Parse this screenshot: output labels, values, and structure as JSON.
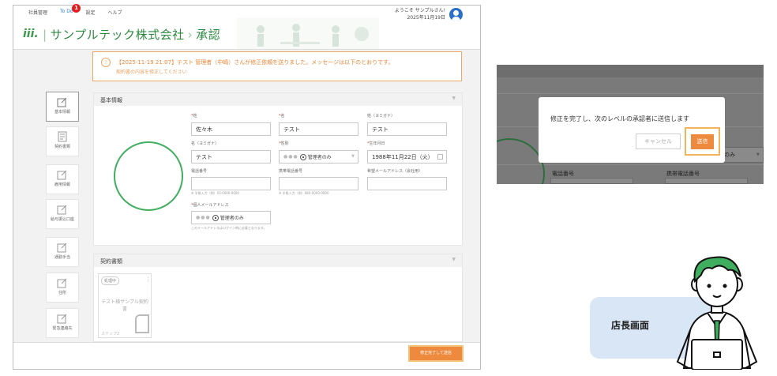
{
  "nav": {
    "items": [
      "社員管理",
      "To Do",
      "設定",
      "ヘルプ"
    ],
    "todo_badge": "1"
  },
  "user": {
    "welcome": "ようこそ サンプルさん!",
    "date": "2025年11月19日"
  },
  "brand": {
    "logo": "iii.",
    "company": "サンプルテック株式会社",
    "separator": "›",
    "page": "承認"
  },
  "alert": {
    "icon": "!",
    "message": "【2025-11-19 21:07】テスト 管理者（中嶋）さんが修正依頼を送りました。メッセージは以下のとおりです。",
    "sub": "契約書の内容を修正してください"
  },
  "sidenav": [
    {
      "label": "基本情報",
      "active": true
    },
    {
      "label": "契約書類",
      "active": false
    },
    {
      "label": "雇用情報",
      "active": false
    },
    {
      "label": "給与振込口座",
      "active": false
    },
    {
      "label": "通勤手当",
      "active": false
    },
    {
      "label": "住所",
      "active": false
    },
    {
      "label": "緊急連絡先",
      "active": false
    }
  ],
  "basic_info": {
    "title": "基本情報",
    "last_name": {
      "label": "姓",
      "required": true,
      "value": "佐々木"
    },
    "first_name": {
      "label": "名",
      "required": true,
      "value": "テスト"
    },
    "last_kana": {
      "label": "姓（ヨミガナ）",
      "required": false,
      "value": "テスト"
    },
    "first_kana": {
      "label": "名（ヨミガナ）",
      "required": false,
      "value": "テスト"
    },
    "gender": {
      "label": "性別",
      "required": true,
      "dots": "●●●",
      "value": "管理者のみ"
    },
    "birthday": {
      "label": "生年月日",
      "required": true,
      "value": "1988年11月22日（火）"
    },
    "phone": {
      "label": "電話番号",
      "value": "",
      "hint": "※ 半角入力（例）03-0000-0000"
    },
    "mobile": {
      "label": "携帯電話番号",
      "value": "",
      "hint": "※ 半角入力（例）080-0000-0000"
    },
    "work_email": {
      "label": "希望メールアドレス（会社用）",
      "value": ""
    },
    "personal_email": {
      "label": "個人メールアドレス",
      "required": true,
      "dots": "●●●",
      "value": "管理者のみ",
      "hint": "このメールアドレスはログイン時に必要となります。"
    }
  },
  "contracts": {
    "title": "契約書類",
    "card": {
      "tag": "処理中",
      "menu": "⋮",
      "title": "テスト様サンプル契約書",
      "step": "ステップ2"
    }
  },
  "footer": {
    "complete_button": "修正完了して送信"
  },
  "modal_shot": {
    "message": "修正を完了し、次のレベルの承認者に送信します",
    "cancel": "キャンセル",
    "send": "送信",
    "bg_phone": "電話番号",
    "bg_mobile": "携帯電話番号",
    "bg_right": "のみ"
  },
  "role": {
    "label": "店長画面"
  },
  "colors": {
    "accent": "#ee8a3e",
    "brand_green": "#2e8a42",
    "link_blue": "#2f7fd6",
    "badge_red": "#e02020"
  }
}
